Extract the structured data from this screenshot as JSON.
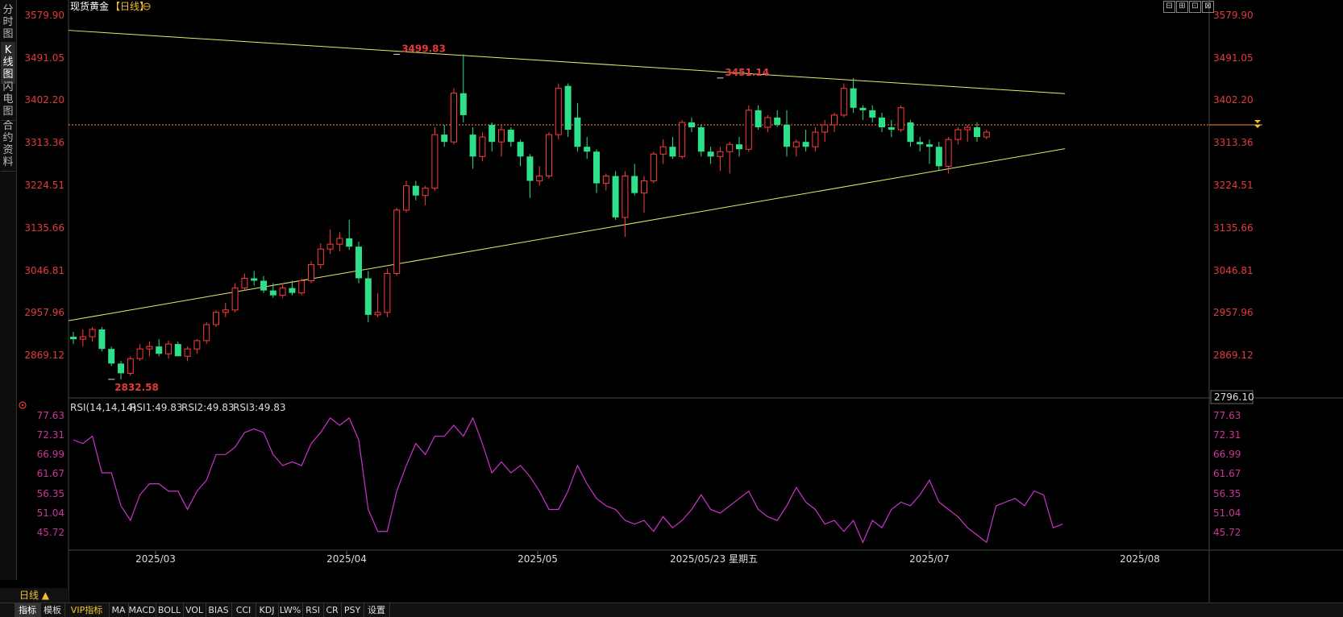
{
  "sidebar": {
    "tabs": [
      {
        "label": "分时图",
        "active": false
      },
      {
        "label": "K线图",
        "active": true
      },
      {
        "label": "闪电图",
        "active": false
      },
      {
        "label": "合约资料",
        "active": false
      }
    ]
  },
  "header": {
    "title": "现货黄金",
    "period_tag": "【日线】",
    "settings_icon": "gear-icon"
  },
  "window_controls": [
    "restore-icon",
    "maximize-icon",
    "fullscreen-icon",
    "close-icon"
  ],
  "price_axis": {
    "left_labels": [
      "3579.90",
      "3491.05",
      "3402.20",
      "3313.36",
      "3224.51",
      "3135.66",
      "3046.81",
      "2957.96",
      "2869.12"
    ],
    "right_labels": [
      "3579.90",
      "3491.05",
      "3402.20",
      "3313.36",
      "3224.51",
      "3135.66",
      "3046.81",
      "2957.96",
      "2869.12"
    ],
    "bottom_value": "2796.10"
  },
  "rsi_panel": {
    "title": "RSI(14,14,14)",
    "rsi1_label": "RSI1:49.83",
    "rsi2_label": "RSI2:49.83",
    "rsi3_label": "RSI3:49.83",
    "axis_labels": [
      "77.63",
      "72.31",
      "66.99",
      "61.67",
      "56.35",
      "51.04",
      "45.72"
    ],
    "colors": {
      "rsi1": "#ffffff",
      "rsi2": "#f2c12e",
      "rsi3": "#cc33cc"
    }
  },
  "x_axis": {
    "labels": [
      "2025/03",
      "2025/04",
      "2025/05",
      "2025/07",
      "2025/08"
    ],
    "cursor_label": "2025/05/23 星期五"
  },
  "period_selector": "日线 ▲",
  "bottom_tabs": [
    {
      "label": "指标",
      "active": true
    },
    {
      "label": "模板"
    },
    {
      "label": "VIP指标",
      "vip": true
    },
    {
      "label": "MA"
    },
    {
      "label": "MACD"
    },
    {
      "label": "BOLL"
    },
    {
      "label": "VOL"
    },
    {
      "label": "BIAS"
    },
    {
      "label": "CCI"
    },
    {
      "label": "KDJ"
    },
    {
      "label": "LW%"
    },
    {
      "label": "RSI"
    },
    {
      "label": "CR"
    },
    {
      "label": "PSY"
    },
    {
      "label": "设置"
    }
  ],
  "chart_data": {
    "type": "candlestick",
    "title": "现货黄金【日线】",
    "ylim": [
      2796.1,
      3579.9
    ],
    "rsi_ylim": [
      45.72,
      77.63
    ],
    "colors": {
      "up": "#ff3b3b",
      "down": "#2ee08a",
      "trendline": "#e8e86a",
      "last_price_line": "#ff8a3a"
    },
    "annotations": [
      {
        "text": "3499.83",
        "type": "high",
        "candle_index": 34,
        "value": 3499.83
      },
      {
        "text": "3451.14",
        "type": "high",
        "candle_index": 68,
        "value": 3451.14
      },
      {
        "text": "2832.58",
        "type": "low",
        "candle_index": 4,
        "value": 2832.58
      }
    ],
    "last_price": 3355,
    "trendlines": [
      {
        "x1_index": 0,
        "y1": 3549,
        "x2_index": 100,
        "y2": 3419
      },
      {
        "x1_index": 0,
        "y1": 2953,
        "x2_index": 100,
        "y2": 3306
      }
    ],
    "candles": [
      {
        "o": 2920,
        "h": 2930,
        "l": 2905,
        "c": 2915
      },
      {
        "o": 2915,
        "h": 2935,
        "l": 2900,
        "c": 2920
      },
      {
        "o": 2920,
        "h": 2940,
        "l": 2910,
        "c": 2935
      },
      {
        "o": 2935,
        "h": 2940,
        "l": 2890,
        "c": 2895
      },
      {
        "o": 2895,
        "h": 2900,
        "l": 2860,
        "c": 2865
      },
      {
        "o": 2865,
        "h": 2870,
        "l": 2832.58,
        "c": 2845
      },
      {
        "o": 2845,
        "h": 2880,
        "l": 2840,
        "c": 2875
      },
      {
        "o": 2875,
        "h": 2905,
        "l": 2870,
        "c": 2895
      },
      {
        "o": 2895,
        "h": 2910,
        "l": 2880,
        "c": 2900
      },
      {
        "o": 2900,
        "h": 2915,
        "l": 2880,
        "c": 2885
      },
      {
        "o": 2885,
        "h": 2912,
        "l": 2875,
        "c": 2905
      },
      {
        "o": 2905,
        "h": 2910,
        "l": 2880,
        "c": 2880
      },
      {
        "o": 2880,
        "h": 2900,
        "l": 2870,
        "c": 2895
      },
      {
        "o": 2895,
        "h": 2915,
        "l": 2885,
        "c": 2912
      },
      {
        "o": 2912,
        "h": 2950,
        "l": 2905,
        "c": 2945
      },
      {
        "o": 2945,
        "h": 2975,
        "l": 2940,
        "c": 2970
      },
      {
        "o": 2970,
        "h": 2990,
        "l": 2960,
        "c": 2975
      },
      {
        "o": 2975,
        "h": 3030,
        "l": 2970,
        "c": 3020
      },
      {
        "o": 3020,
        "h": 3050,
        "l": 3015,
        "c": 3040
      },
      {
        "o": 3040,
        "h": 3055,
        "l": 3025,
        "c": 3035
      },
      {
        "o": 3035,
        "h": 3045,
        "l": 3010,
        "c": 3015
      },
      {
        "o": 3015,
        "h": 3030,
        "l": 3000,
        "c": 3005
      },
      {
        "o": 3005,
        "h": 3030,
        "l": 3000,
        "c": 3020
      },
      {
        "o": 3020,
        "h": 3035,
        "l": 3005,
        "c": 3010
      },
      {
        "o": 3010,
        "h": 3040,
        "l": 3005,
        "c": 3035
      },
      {
        "o": 3035,
        "h": 3075,
        "l": 3030,
        "c": 3068
      },
      {
        "o": 3068,
        "h": 3112,
        "l": 3060,
        "c": 3100
      },
      {
        "o": 3100,
        "h": 3140,
        "l": 3090,
        "c": 3110
      },
      {
        "o": 3110,
        "h": 3135,
        "l": 3095,
        "c": 3122
      },
      {
        "o": 3122,
        "h": 3160,
        "l": 3098,
        "c": 3105
      },
      {
        "o": 3105,
        "h": 3115,
        "l": 3030,
        "c": 3040
      },
      {
        "o": 3040,
        "h": 3055,
        "l": 2950,
        "c": 2965
      },
      {
        "o": 2965,
        "h": 3010,
        "l": 2960,
        "c": 2970
      },
      {
        "o": 2970,
        "h": 3060,
        "l": 2960,
        "c": 3050
      },
      {
        "o": 3050,
        "h": 3185,
        "l": 3045,
        "c": 3180
      },
      {
        "o": 3180,
        "h": 3240,
        "l": 3175,
        "c": 3230
      },
      {
        "o": 3230,
        "h": 3240,
        "l": 3200,
        "c": 3210
      },
      {
        "o": 3210,
        "h": 3230,
        "l": 3190,
        "c": 3225
      },
      {
        "o": 3225,
        "h": 3350,
        "l": 3220,
        "c": 3335
      },
      {
        "o": 3335,
        "h": 3355,
        "l": 3310,
        "c": 3320
      },
      {
        "o": 3320,
        "h": 3430,
        "l": 3315,
        "c": 3420
      },
      {
        "o": 3420,
        "h": 3499.83,
        "l": 3360,
        "c": 3375
      },
      {
        "o": 3335,
        "h": 3350,
        "l": 3265,
        "c": 3290
      },
      {
        "o": 3290,
        "h": 3340,
        "l": 3280,
        "c": 3330
      },
      {
        "o": 3355,
        "h": 3360,
        "l": 3300,
        "c": 3320
      },
      {
        "o": 3320,
        "h": 3355,
        "l": 3290,
        "c": 3345
      },
      {
        "o": 3345,
        "h": 3350,
        "l": 3310,
        "c": 3320
      },
      {
        "o": 3320,
        "h": 3325,
        "l": 3270,
        "c": 3290
      },
      {
        "o": 3290,
        "h": 3295,
        "l": 3205,
        "c": 3240
      },
      {
        "o": 3240,
        "h": 3270,
        "l": 3230,
        "c": 3250
      },
      {
        "o": 3250,
        "h": 3340,
        "l": 3245,
        "c": 3335
      },
      {
        "o": 3335,
        "h": 3440,
        "l": 3325,
        "c": 3430
      },
      {
        "o": 3435,
        "h": 3440,
        "l": 3330,
        "c": 3345
      },
      {
        "o": 3370,
        "h": 3400,
        "l": 3300,
        "c": 3310
      },
      {
        "o": 3310,
        "h": 3330,
        "l": 3285,
        "c": 3300
      },
      {
        "o": 3300,
        "h": 3305,
        "l": 3215,
        "c": 3235
      },
      {
        "o": 3235,
        "h": 3255,
        "l": 3220,
        "c": 3250
      },
      {
        "o": 3250,
        "h": 3260,
        "l": 3160,
        "c": 3165
      },
      {
        "o": 3165,
        "h": 3260,
        "l": 3125,
        "c": 3250
      },
      {
        "o": 3250,
        "h": 3275,
        "l": 3210,
        "c": 3215
      },
      {
        "o": 3215,
        "h": 3250,
        "l": 3175,
        "c": 3240
      },
      {
        "o": 3240,
        "h": 3300,
        "l": 3235,
        "c": 3295
      },
      {
        "o": 3295,
        "h": 3325,
        "l": 3275,
        "c": 3310
      },
      {
        "o": 3310,
        "h": 3330,
        "l": 3285,
        "c": 3290
      },
      {
        "o": 3290,
        "h": 3365,
        "l": 3285,
        "c": 3360
      },
      {
        "o": 3360,
        "h": 3370,
        "l": 3340,
        "c": 3350
      },
      {
        "o": 3350,
        "h": 3355,
        "l": 3290,
        "c": 3300
      },
      {
        "o": 3300,
        "h": 3310,
        "l": 3275,
        "c": 3290
      },
      {
        "o": 3290,
        "h": 3310,
        "l": 3260,
        "c": 3300
      },
      {
        "o": 3300,
        "h": 3320,
        "l": 3255,
        "c": 3315
      },
      {
        "o": 3315,
        "h": 3330,
        "l": 3290,
        "c": 3305
      },
      {
        "o": 3305,
        "h": 3395,
        "l": 3300,
        "c": 3385
      },
      {
        "o": 3385,
        "h": 3395,
        "l": 3345,
        "c": 3350
      },
      {
        "o": 3350,
        "h": 3375,
        "l": 3340,
        "c": 3370
      },
      {
        "o": 3370,
        "h": 3385,
        "l": 3350,
        "c": 3355
      },
      {
        "o": 3355,
        "h": 3385,
        "l": 3290,
        "c": 3310
      },
      {
        "o": 3310,
        "h": 3325,
        "l": 3290,
        "c": 3320
      },
      {
        "o": 3320,
        "h": 3345,
        "l": 3300,
        "c": 3310
      },
      {
        "o": 3310,
        "h": 3350,
        "l": 3300,
        "c": 3340
      },
      {
        "o": 3340,
        "h": 3365,
        "l": 3320,
        "c": 3355
      },
      {
        "o": 3355,
        "h": 3380,
        "l": 3340,
        "c": 3375
      },
      {
        "o": 3375,
        "h": 3440,
        "l": 3370,
        "c": 3430
      },
      {
        "o": 3430,
        "h": 3451.14,
        "l": 3380,
        "c": 3390
      },
      {
        "o": 3390,
        "h": 3395,
        "l": 3365,
        "c": 3385
      },
      {
        "o": 3385,
        "h": 3395,
        "l": 3360,
        "c": 3370
      },
      {
        "o": 3370,
        "h": 3380,
        "l": 3340,
        "c": 3350
      },
      {
        "o": 3350,
        "h": 3365,
        "l": 3330,
        "c": 3345
      },
      {
        "o": 3345,
        "h": 3395,
        "l": 3340,
        "c": 3390
      },
      {
        "o": 3360,
        "h": 3365,
        "l": 3310,
        "c": 3320
      },
      {
        "o": 3320,
        "h": 3330,
        "l": 3300,
        "c": 3315
      },
      {
        "o": 3315,
        "h": 3325,
        "l": 3275,
        "c": 3310
      },
      {
        "o": 3310,
        "h": 3320,
        "l": 3260,
        "c": 3270
      },
      {
        "o": 3270,
        "h": 3330,
        "l": 3255,
        "c": 3325
      },
      {
        "o": 3325,
        "h": 3350,
        "l": 3315,
        "c": 3345
      },
      {
        "o": 3345,
        "h": 3355,
        "l": 3320,
        "c": 3350
      },
      {
        "o": 3350,
        "h": 3360,
        "l": 3320,
        "c": 3330
      },
      {
        "o": 3330,
        "h": 3345,
        "l": 3325,
        "c": 3340
      }
    ],
    "rsi": [
      71,
      70,
      72,
      62,
      62,
      53,
      49,
      56,
      59,
      59,
      57,
      57,
      52,
      57,
      60,
      67,
      67,
      69,
      73,
      74,
      73,
      67,
      64,
      65,
      64,
      70,
      73,
      77,
      75,
      77,
      71,
      52,
      46,
      46,
      57,
      64,
      70,
      67,
      72,
      72,
      75,
      72,
      77,
      70,
      62,
      65,
      62,
      64,
      61,
      57,
      52,
      52,
      57,
      64,
      59,
      55,
      53,
      52,
      49,
      48,
      49,
      46,
      50,
      47,
      49,
      52,
      56,
      52,
      51,
      53,
      55,
      57,
      52,
      50,
      49,
      53,
      58,
      54,
      52,
      48,
      49,
      46,
      49,
      43,
      49,
      47,
      52,
      54,
      53,
      56,
      60,
      54,
      52,
      50,
      47,
      45,
      43,
      53,
      54,
      55,
      53,
      57,
      56,
      47,
      48
    ]
  }
}
